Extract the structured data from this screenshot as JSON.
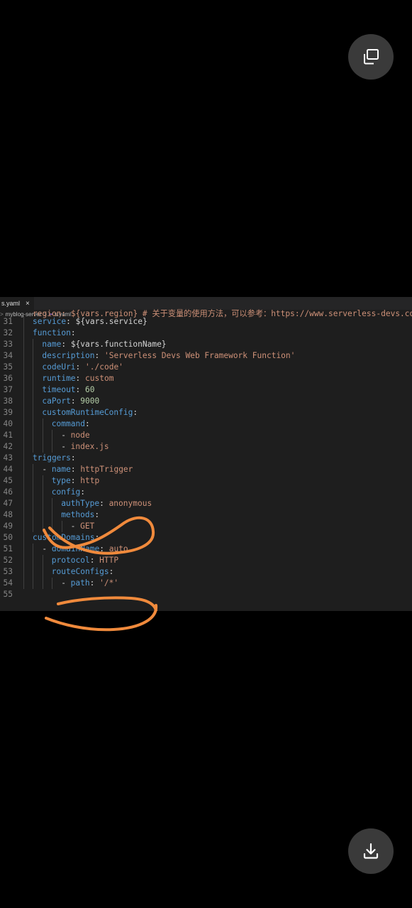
{
  "tab": {
    "filename": "s.yaml",
    "close_glyph": "×"
  },
  "breadcrumb": {
    "folder": "myblog-server",
    "separator": ">",
    "file": "s.yaml"
  },
  "topline_text": "region: ${vars.region} # 关于变量的使用方法，可以参考：https://www.serverless-devs.com/serverless-devs/yaml#变量赋值",
  "lines": [
    {
      "num": "31",
      "indent": 1,
      "key": "service",
      "value": " ${vars.service}",
      "vtype": "p"
    },
    {
      "num": "32",
      "indent": 1,
      "key": "function",
      "value": "",
      "vtype": "p"
    },
    {
      "num": "33",
      "indent": 2,
      "key": "name",
      "value": " ${vars.functionName}",
      "vtype": "p"
    },
    {
      "num": "34",
      "indent": 2,
      "key": "description",
      "value": " 'Serverless Devs Web Framework Function'",
      "vtype": "s"
    },
    {
      "num": "35",
      "indent": 2,
      "key": "codeUri",
      "value": " './code'",
      "vtype": "s"
    },
    {
      "num": "36",
      "indent": 2,
      "key": "runtime",
      "value": " custom",
      "vtype": "s"
    },
    {
      "num": "37",
      "indent": 2,
      "key": "timeout",
      "value": " 60",
      "vtype": "n"
    },
    {
      "num": "38",
      "indent": 2,
      "key": "caPort",
      "value": " 9000",
      "vtype": "n"
    },
    {
      "num": "39",
      "indent": 2,
      "key": "customRuntimeConfig",
      "value": "",
      "vtype": "p"
    },
    {
      "num": "40",
      "indent": 3,
      "key": "command",
      "value": "",
      "vtype": "p"
    },
    {
      "num": "41",
      "indent": 4,
      "dash": true,
      "key": "",
      "value": "node",
      "vtype": "s"
    },
    {
      "num": "42",
      "indent": 4,
      "dash": true,
      "key": "",
      "value": "index.js",
      "vtype": "s"
    },
    {
      "num": "43",
      "indent": 1,
      "key": "triggers",
      "value": "",
      "vtype": "p"
    },
    {
      "num": "44",
      "indent": 2,
      "dash": true,
      "key": "name",
      "value": " httpTrigger",
      "vtype": "s"
    },
    {
      "num": "45",
      "indent": 3,
      "key": "type",
      "value": " http",
      "vtype": "s"
    },
    {
      "num": "46",
      "indent": 3,
      "key": "config",
      "value": "",
      "vtype": "p"
    },
    {
      "num": "47",
      "indent": 4,
      "key": "authType",
      "value": " anonymous",
      "vtype": "s"
    },
    {
      "num": "48",
      "indent": 4,
      "key": "methods",
      "value": "",
      "vtype": "p"
    },
    {
      "num": "49",
      "indent": 5,
      "dash": true,
      "key": "",
      "value": "GET",
      "vtype": "s"
    },
    {
      "num": "50",
      "indent": 1,
      "key": "customDomains",
      "value": "",
      "vtype": "p"
    },
    {
      "num": "51",
      "indent": 2,
      "dash": true,
      "key": "domainName",
      "value": " auto",
      "vtype": "s"
    },
    {
      "num": "52",
      "indent": 3,
      "key": "protocol",
      "value": " HTTP",
      "vtype": "s"
    },
    {
      "num": "53",
      "indent": 3,
      "key": "routeConfigs",
      "value": "",
      "vtype": "p"
    },
    {
      "num": "54",
      "indent": 4,
      "dash": true,
      "key": "path",
      "value": " '/*'",
      "vtype": "s"
    },
    {
      "num": "55",
      "indent": 0,
      "key": "",
      "value": "",
      "vtype": "p"
    }
  ],
  "colors": {
    "annotation": "#f08a3c",
    "key": "#569cd6",
    "string": "#ce9178",
    "number": "#b5cea8"
  },
  "icons": {
    "top_right": "open-in-window-icon",
    "bottom_right": "download-icon"
  }
}
